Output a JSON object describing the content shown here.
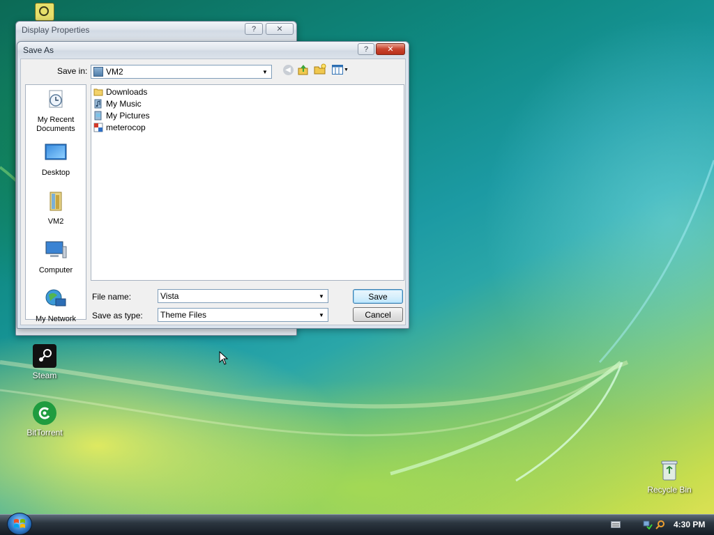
{
  "desktop": {
    "icons": [
      {
        "label": "Steam",
        "icon": "steam-icon"
      },
      {
        "label": "BitTorrent",
        "icon": "bittorrent-icon"
      },
      {
        "label": "Recycle Bin",
        "icon": "recycle-bin-icon"
      }
    ]
  },
  "display_properties": {
    "title": "Display Properties",
    "help_label": "?",
    "close_label": "✕"
  },
  "save_as": {
    "title": "Save As",
    "help_label": "?",
    "close_label": "✕",
    "save_in_label": "Save in:",
    "save_in_value": "VM2",
    "places": [
      {
        "label": "My Recent Documents",
        "icon": "recent-documents-icon"
      },
      {
        "label": "Desktop",
        "icon": "desktop-icon"
      },
      {
        "label": "VM2",
        "icon": "user-folder-icon"
      },
      {
        "label": "Computer",
        "icon": "computer-icon"
      },
      {
        "label": "My Network",
        "icon": "network-icon"
      }
    ],
    "files": [
      {
        "name": "Downloads",
        "icon": "folder-icon"
      },
      {
        "name": "My Music",
        "icon": "music-folder-icon"
      },
      {
        "name": "My Pictures",
        "icon": "pictures-folder-icon"
      },
      {
        "name": "meterocop",
        "icon": "theme-file-icon"
      }
    ],
    "file_name_label": "File name:",
    "file_name_value": "Vista",
    "save_as_type_label": "Save as type:",
    "save_as_type_value": "Theme Files",
    "save_button": "Save",
    "cancel_button": "Cancel"
  },
  "taskbar": {
    "clock": "4:30 PM"
  }
}
